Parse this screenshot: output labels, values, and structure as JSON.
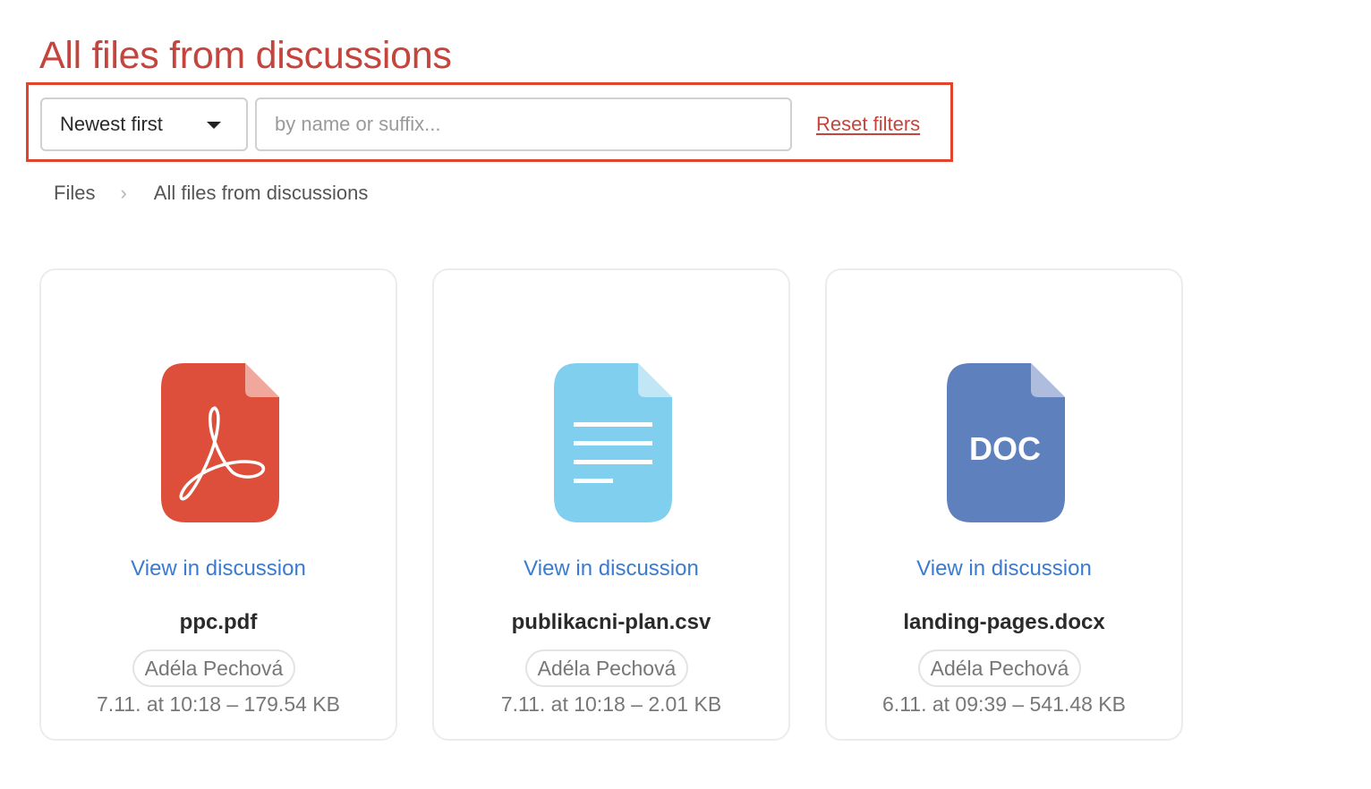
{
  "page": {
    "title": "All files from discussions"
  },
  "filters": {
    "sort_selected": "Newest first",
    "search_placeholder": "by name or suffix...",
    "search_value": "",
    "reset_label": "Reset filters",
    "highlight_color": "#e0442c"
  },
  "breadcrumb": {
    "items": [
      {
        "label": "Files"
      },
      {
        "label": "All files from discussions"
      }
    ],
    "separator_icon": "chevron-right-icon"
  },
  "files": [
    {
      "icon": "pdf-file-icon",
      "icon_color": "#dd4f3b",
      "view_link": "View in discussion",
      "name": "ppc.pdf",
      "author": "Adéla Pechová",
      "meta": "7.11. at 10:18 – 179.54 KB"
    },
    {
      "icon": "text-file-icon",
      "icon_color": "#80cfee",
      "view_link": "View in discussion",
      "name": "publikacni-plan.csv",
      "author": "Adéla Pechová",
      "meta": "7.11. at 10:18 – 2.01 KB"
    },
    {
      "icon": "doc-file-icon",
      "icon_color": "#5e80bd",
      "icon_text": "DOC",
      "view_link": "View in discussion",
      "name": "landing-pages.docx",
      "author": "Adéla Pechová",
      "meta": "6.11. at 09:39 – 541.48 KB"
    }
  ]
}
